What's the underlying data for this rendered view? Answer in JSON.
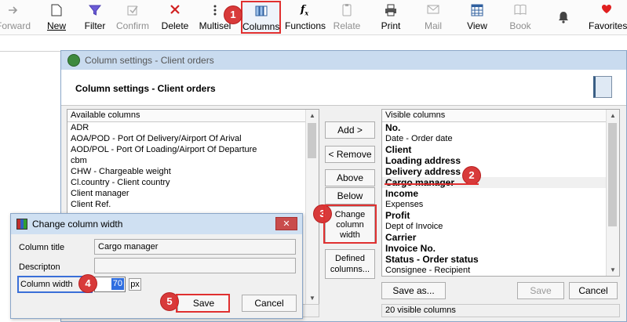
{
  "toolbar": {
    "items": [
      {
        "label": "Forward",
        "icon": "arrow-right-icon"
      },
      {
        "label": "New",
        "icon": "new-document-icon"
      },
      {
        "label": "Filter",
        "icon": "filter-icon"
      },
      {
        "label": "Confirm",
        "icon": "confirm-icon"
      },
      {
        "label": "Delete",
        "icon": "delete-x-icon"
      },
      {
        "label": "Multisel",
        "icon": "multiselect-icon"
      },
      {
        "label": "Columns",
        "icon": "columns-icon"
      },
      {
        "label": "Functions",
        "icon": "functions-icon"
      },
      {
        "label": "Relate",
        "icon": "relate-icon"
      },
      {
        "label": "Print",
        "icon": "printer-icon"
      },
      {
        "label": "Mail",
        "icon": "mail-icon"
      },
      {
        "label": "View",
        "icon": "view-icon"
      },
      {
        "label": "Book",
        "icon": "book-icon"
      },
      {
        "label": "",
        "icon": "bell-icon"
      },
      {
        "label": "Favorites",
        "icon": "heart-icon"
      }
    ]
  },
  "dialog": {
    "title": "Column settings - Client orders",
    "heading": "Column settings - Client orders",
    "available": {
      "header": "Available columns",
      "items": [
        "ADR",
        "AOA/POD - Port Of Delivery/Airport Of Arival",
        "AOD/POL - Port Of Loading/Airport Of Departure",
        "cbm",
        "CHW - Chargeable weight",
        "Cl.country - Client country",
        "Client manager",
        "Client Ref."
      ]
    },
    "visible": {
      "header": "Visible columns",
      "items": [
        {
          "label": "No.",
          "bold": true
        },
        {
          "label": "Date - Order date",
          "bold": false
        },
        {
          "label": "Client",
          "bold": true
        },
        {
          "label": "Loading address",
          "bold": true
        },
        {
          "label": "Delivery address",
          "bold": true
        },
        {
          "label": "Cargo manager",
          "bold": true
        },
        {
          "label": "Income",
          "bold": true
        },
        {
          "label": "Expenses",
          "bold": false
        },
        {
          "label": "Profit",
          "bold": true
        },
        {
          "label": "Dept of Invoice",
          "bold": false
        },
        {
          "label": "Carrier",
          "bold": true
        },
        {
          "label": "Invoice No.",
          "bold": true
        },
        {
          "label": "Status - Order status",
          "bold": true
        },
        {
          "label": "Consignee - Recipient",
          "bold": false
        }
      ]
    },
    "buttons": {
      "add": "Add >",
      "remove": "< Remove",
      "above": "Above",
      "below": "Below",
      "change_width": "Change column width",
      "defined": "Defined columns...",
      "save_as": "Save as...",
      "save": "Save",
      "cancel": "Cancel"
    },
    "status_visible": "20 visible columns"
  },
  "subdialog": {
    "title": "Change column width",
    "column_title_label": "Column title",
    "column_title_value": "Cargo manager",
    "description_label": "Descripton",
    "description_value": "",
    "width_label": "Column width",
    "width_value": "70",
    "unit": "px",
    "save": "Save",
    "cancel": "Cancel"
  },
  "badges": [
    "1",
    "2",
    "3",
    "4",
    "5"
  ],
  "colors": {
    "highlight": "#e03030",
    "badge": "#d83a3a",
    "title_bar": "#c9dbef"
  }
}
